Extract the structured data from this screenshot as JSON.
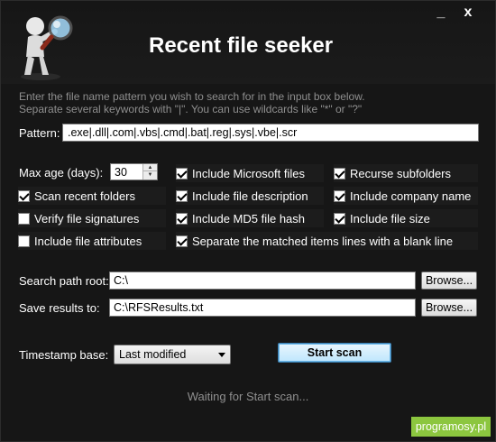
{
  "app": {
    "title": "Recent file seeker"
  },
  "window_controls": {
    "minimize": "_",
    "close": "x"
  },
  "instructions": {
    "line1": "Enter the file name pattern you wish to search for in the input box below.",
    "line2": "Separate several keywords with \"|\". You can use wildcards like \"*\" or \"?\""
  },
  "pattern": {
    "label": "Pattern:",
    "value": ".exe|.dll|.com|.vbs|.cmd|.bat|.reg|.sys|.vbe|.scr"
  },
  "max_age": {
    "label": "Max age (days):",
    "value": "30"
  },
  "options": [
    {
      "label": "Include Microsoft files",
      "checked": true
    },
    {
      "label": "Recurse subfolders",
      "checked": true
    },
    {
      "label": "Scan recent folders",
      "checked": true
    },
    {
      "label": "Include file description",
      "checked": true
    },
    {
      "label": "Include company name",
      "checked": true
    },
    {
      "label": "Verify file signatures",
      "checked": false
    },
    {
      "label": "Include MD5 file hash",
      "checked": true
    },
    {
      "label": "Include file size",
      "checked": true
    },
    {
      "label": "Include file attributes",
      "checked": false
    },
    {
      "label": "Separate the matched items lines with a blank line",
      "checked": true
    }
  ],
  "search_path": {
    "label": "Search path root:",
    "value": "C:\\",
    "browse_label": "Browse..."
  },
  "save_results": {
    "label": "Save results to:",
    "value": "C:\\RFSResults.txt",
    "browse_label": "Browse..."
  },
  "timestamp": {
    "label": "Timestamp base:",
    "selected": "Last modified"
  },
  "start_button": {
    "label": "Start scan"
  },
  "status": {
    "text": "Waiting for Start scan..."
  },
  "watermark": {
    "text": "programosy.pl"
  },
  "colors": {
    "background": "#161616",
    "watermark": "#8cc63f",
    "muted_text": "#8f8f8f"
  }
}
